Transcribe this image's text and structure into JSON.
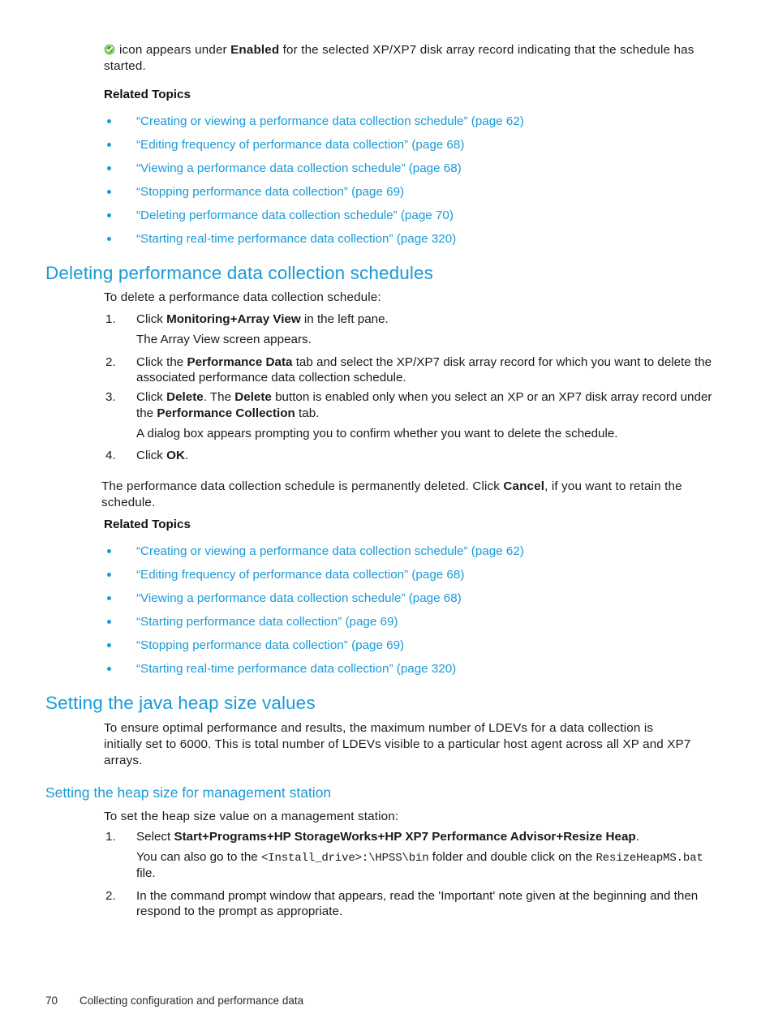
{
  "document": {
    "intro": {
      "icon": "green-check-icon",
      "line_a_pre": "icon appears under ",
      "line_a_bold": "Enabled",
      "line_a_post": " for the selected XP/XP7 disk array record indicating that the schedule has started.",
      "related_topics_label": "Related Topics"
    },
    "related_topics_1": [
      {
        "text": "“Creating or viewing a performance data collection schedule” (page 62)"
      },
      {
        "text": "“Editing frequency of performance data collection” (page 68)"
      },
      {
        "text": "“Viewing a performance data collection schedule” (page 68)"
      },
      {
        "text": "“Stopping performance data collection” (page 69)"
      },
      {
        "text": "“Deleting performance data collection schedule” (page 70)"
      },
      {
        "text": "“Starting real-time performance data collection” (page 320)"
      }
    ],
    "section_delete": {
      "heading": "Deleting performance data collection schedules",
      "lead": "To delete a performance data collection schedule:",
      "steps": [
        {
          "num": "1.",
          "pre": "Click ",
          "b1": "Monitoring",
          "mid1": "+",
          "b2": "Array View",
          "post": " in the left pane.",
          "sub": "The Array View screen appears."
        },
        {
          "num": "2.",
          "pre": "Click the ",
          "b1": "Performance Data",
          "post": " tab and select the XP/XP7 disk array record for which you want to delete the associated performance data collection schedule."
        },
        {
          "num": "3.",
          "pre": "Click ",
          "b1": "Delete",
          "mid1": ". The ",
          "b2": "Delete",
          "mid2": " button is enabled only when you select an XP or an XP7 disk array record under the ",
          "b3": "Performance Collection",
          "post": " tab.",
          "sub": "A dialog box appears prompting you to confirm whether you want to delete the schedule."
        },
        {
          "num": "4.",
          "pre": "Click ",
          "b1": "OK",
          "post": "."
        }
      ],
      "closing_pre": "The performance data collection schedule is permanently deleted. Click ",
      "closing_bold": "Cancel",
      "closing_post": ", if you want to retain the schedule.",
      "related_topics_label": "Related Topics"
    },
    "related_topics_2": [
      {
        "text": "“Creating or viewing a performance data collection schedule” (page 62)"
      },
      {
        "text": "“Editing frequency of performance data collection” (page 68)"
      },
      {
        "text": "“Viewing a performance data collection schedule” (page 68)"
      },
      {
        "text": "“Starting performance data collection” (page 69)"
      },
      {
        "text": "“Stopping performance data collection” (page 69)"
      },
      {
        "text": "“Starting real-time performance data collection” (page 320)"
      }
    ],
    "section_heap": {
      "heading": "Setting the java heap size values",
      "paragraph": "To ensure optimal performance and results, the maximum number of LDEVs for a data collection is initially set to 6000. This is total number of LDEVs visible to a particular host agent across all XP and XP7 arrays.",
      "sub_heading": "Setting the heap size for management station",
      "lead": "To set the heap size value on a management station:",
      "steps": [
        {
          "num": "1.",
          "pre": "Select ",
          "b1": "Start",
          "mid1": "+",
          "b2": "Programs",
          "mid2": "+",
          "b3": "HP StorageWorks",
          "mid3": "+",
          "b4": "HP XP7 Performance Advisor",
          "mid4": "+",
          "b5": "Resize Heap",
          "post": ".",
          "sub_pre": "You can also go to the ",
          "sub_mono1": "<Install_drive>:\\HPSS\\bin",
          "sub_mid": " folder and double click on the ",
          "sub_mono2": "ResizeHeapMS.bat",
          "sub_post": " file."
        },
        {
          "num": "2.",
          "pre": "In the command prompt window that appears, read the 'Important' note given at the beginning and then respond to the prompt as appropriate."
        }
      ]
    },
    "footer": {
      "page_number": "70",
      "chapter": "Collecting configuration and performance data"
    },
    "colors": {
      "heading_blue": "#1b9ad6",
      "link_blue": "#1b9ad6",
      "body_black": "#1c1c1c",
      "check_green": "#5aaa28"
    }
  }
}
